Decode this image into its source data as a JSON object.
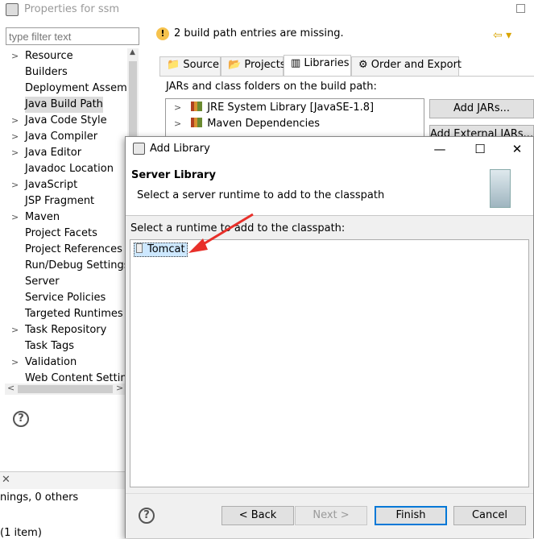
{
  "props": {
    "title": "Properties for ssm",
    "filter_placeholder": "type filter text",
    "tree": [
      {
        "label": "Resource",
        "arrow": true
      },
      {
        "label": "Builders",
        "arrow": false
      },
      {
        "label": "Deployment Assembly",
        "arrow": false
      },
      {
        "label": "Java Build Path",
        "arrow": false,
        "selected": true
      },
      {
        "label": "Java Code Style",
        "arrow": true
      },
      {
        "label": "Java Compiler",
        "arrow": true
      },
      {
        "label": "Java Editor",
        "arrow": true
      },
      {
        "label": "Javadoc Location",
        "arrow": false
      },
      {
        "label": "JavaScript",
        "arrow": true
      },
      {
        "label": "JSP Fragment",
        "arrow": false
      },
      {
        "label": "Maven",
        "arrow": true
      },
      {
        "label": "Project Facets",
        "arrow": false
      },
      {
        "label": "Project References",
        "arrow": false
      },
      {
        "label": "Run/Debug Settings",
        "arrow": false
      },
      {
        "label": "Server",
        "arrow": false
      },
      {
        "label": "Service Policies",
        "arrow": false
      },
      {
        "label": "Targeted Runtimes",
        "arrow": false
      },
      {
        "label": "Task Repository",
        "arrow": true
      },
      {
        "label": "Task Tags",
        "arrow": false
      },
      {
        "label": "Validation",
        "arrow": true
      },
      {
        "label": "Web Content Settings",
        "arrow": false
      }
    ],
    "warning": "2 build path entries are missing.",
    "tabs": [
      "Source",
      "Projects",
      "Libraries",
      "Order and Export"
    ],
    "build_label": "JARs and class folders on the build path:",
    "jars": [
      "JRE System Library [JavaSE-1.8]",
      "Maven Dependencies"
    ],
    "side_buttons": [
      "Add JARs...",
      "Add External JARs..."
    ],
    "bottom_tab_close": "✕",
    "bottom_status": "nings, 0 others",
    "bottom_count": "(1 item)"
  },
  "dialog": {
    "title": "Add Library",
    "heading": "Server Library",
    "subheading": "Select a server runtime to add to the classpath",
    "select_label": "Select a runtime to add to the classpath:",
    "runtimes": [
      "Tomcat"
    ],
    "buttons": {
      "back": "< Back",
      "next": "Next >",
      "finish": "Finish",
      "cancel": "Cancel"
    },
    "help": "?"
  },
  "colors": {
    "accent": "#0078d7",
    "annotation_arrow": "#e8302a",
    "selection": "#cde8ff"
  }
}
